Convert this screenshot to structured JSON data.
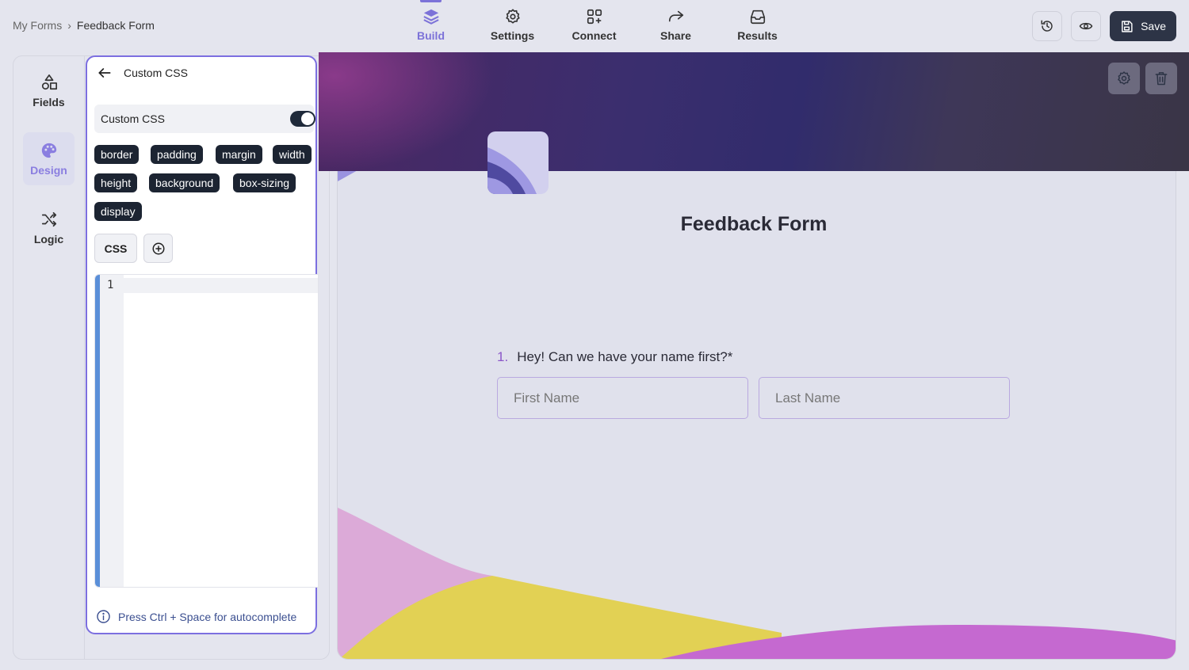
{
  "breadcrumb": {
    "parent": "My Forms",
    "separator": "›",
    "current": "Feedback Form"
  },
  "nav": {
    "tabs": [
      {
        "label": "Build",
        "icon": "layers-icon",
        "active": true
      },
      {
        "label": "Settings",
        "icon": "gear-icon"
      },
      {
        "label": "Connect",
        "icon": "grid-plus-icon"
      },
      {
        "label": "Share",
        "icon": "share-arrow-icon"
      },
      {
        "label": "Results",
        "icon": "inbox-icon"
      }
    ]
  },
  "actions": {
    "save_label": "Save"
  },
  "rail": {
    "tabs": [
      {
        "label": "Fields",
        "icon": "shapes-icon"
      },
      {
        "label": "Design",
        "icon": "palette-icon",
        "active": true
      },
      {
        "label": "Logic",
        "icon": "shuffle-icon"
      }
    ]
  },
  "panel": {
    "title": "Custom CSS",
    "toggle_label": "Custom CSS",
    "toggle_on": true,
    "chips": [
      "border",
      "padding",
      "margin",
      "width",
      "height",
      "background",
      "box-sizing",
      "display"
    ],
    "css_button": "CSS",
    "editor_line_number": "1",
    "hint": "Press Ctrl + Space for autocomplete"
  },
  "form": {
    "title": "Feedback Form",
    "question_number": "1.",
    "question_text": "Hey! Can we have your name first?",
    "required_mark": "*",
    "first_name_placeholder": "First Name",
    "last_name_placeholder": "Last Name"
  },
  "colors": {
    "accent": "#7c72d8",
    "save_button": "#2d3446",
    "chip": "#1c2432",
    "wave_pink": "#dcaad8",
    "wave_yellow": "#e2d154",
    "wave_purple": "#c569d0"
  }
}
